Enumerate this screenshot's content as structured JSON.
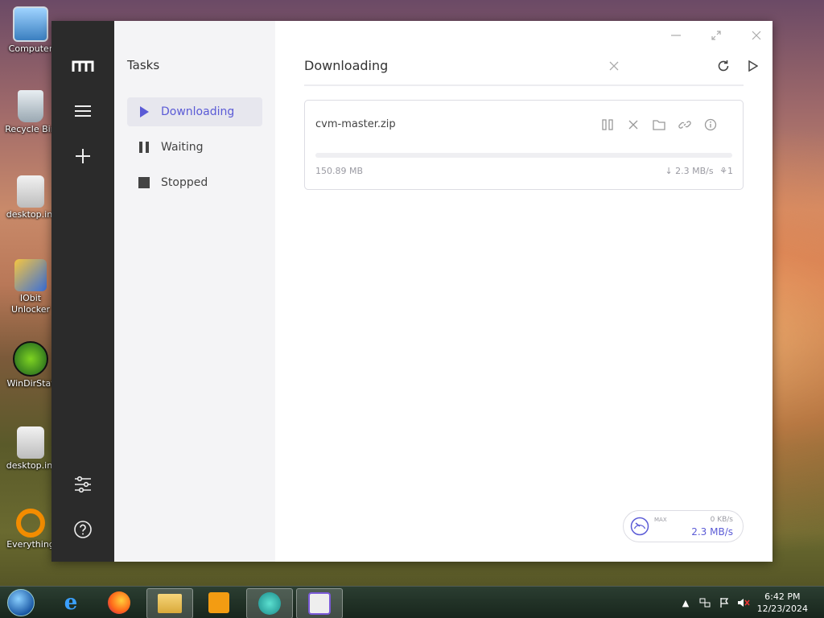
{
  "desktop": {
    "icons": [
      {
        "label": "Computer"
      },
      {
        "label": "Recycle Bin"
      },
      {
        "label": "desktop.ini"
      },
      {
        "label": "IObit Unlocker"
      },
      {
        "label": "WinDirStat"
      },
      {
        "label": "desktop.ini"
      },
      {
        "label": "Everything"
      }
    ]
  },
  "app": {
    "sidebar": {
      "title": "Tasks",
      "items": [
        {
          "label": "Downloading",
          "icon": "play-icon",
          "active": true
        },
        {
          "label": "Waiting",
          "icon": "pause-icon",
          "active": false
        },
        {
          "label": "Stopped",
          "icon": "stop-icon",
          "active": false
        }
      ]
    },
    "main": {
      "heading": "Downloading"
    },
    "task": {
      "filename": "cvm-master.zip",
      "size": "150.89 MB",
      "speed": "2.3 MB/s",
      "connections": "1",
      "progress": 0
    },
    "speedometer": {
      "max_label": "MAX",
      "upload": "0 KB/s",
      "download": "2.3 MB/s"
    },
    "colors": {
      "accent": "#5b5bd6",
      "rail": "#2b2b2b",
      "sidebar": "#f4f4f6"
    }
  },
  "taskbar": {
    "time": "6:42 PM",
    "date": "12/23/2024"
  }
}
